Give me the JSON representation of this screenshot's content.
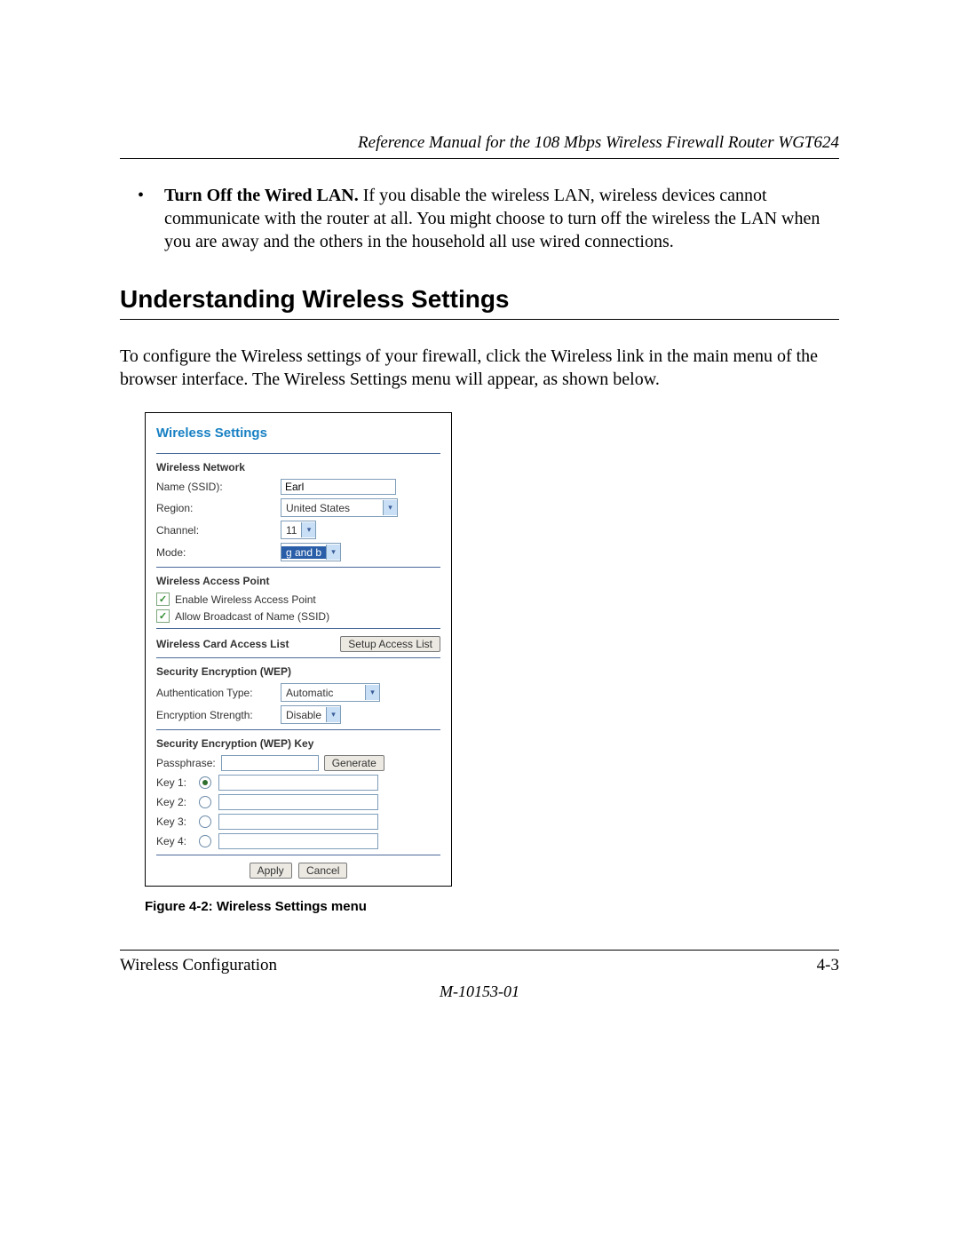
{
  "header": {
    "manual_title": "Reference Manual for the 108 Mbps Wireless Firewall Router WGT624"
  },
  "bullet": {
    "lead": "Turn Off the Wired LAN.",
    "rest": " If you disable the wireless LAN, wireless devices cannot communicate with the router at all. You might choose to turn off the wireless the LAN when you are away and the others in the household all use wired connections."
  },
  "section_heading": "Understanding Wireless Settings",
  "intro_para": "To configure the Wireless settings of your firewall, click the Wireless link in the main menu of the browser interface. The Wireless Settings menu will appear, as shown below.",
  "panel": {
    "title": "Wireless Settings",
    "network": {
      "heading": "Wireless Network",
      "ssid_label": "Name (SSID):",
      "ssid_value": "Earl",
      "region_label": "Region:",
      "region_value": "United States",
      "channel_label": "Channel:",
      "channel_value": "11",
      "mode_label": "Mode:",
      "mode_value": "g and b"
    },
    "ap": {
      "heading": "Wireless Access Point",
      "enable_label": "Enable Wireless Access Point",
      "broadcast_label": "Allow Broadcast of Name (SSID)"
    },
    "acl": {
      "heading": "Wireless Card Access List",
      "button": "Setup Access List"
    },
    "wep": {
      "heading": "Security Encryption (WEP)",
      "auth_label": "Authentication Type:",
      "auth_value": "Automatic",
      "strength_label": "Encryption Strength:",
      "strength_value": "Disable"
    },
    "wepkey": {
      "heading": "Security Encryption (WEP) Key",
      "passphrase_label": "Passphrase:",
      "generate": "Generate",
      "k1": "Key 1:",
      "k2": "Key 2:",
      "k3": "Key 3:",
      "k4": "Key 4:"
    },
    "apply": "Apply",
    "cancel": "Cancel"
  },
  "figure_caption": "Figure 4-2:  Wireless Settings menu",
  "footer": {
    "section": "Wireless Configuration",
    "page": "4-3",
    "docnum": "M-10153-01"
  }
}
